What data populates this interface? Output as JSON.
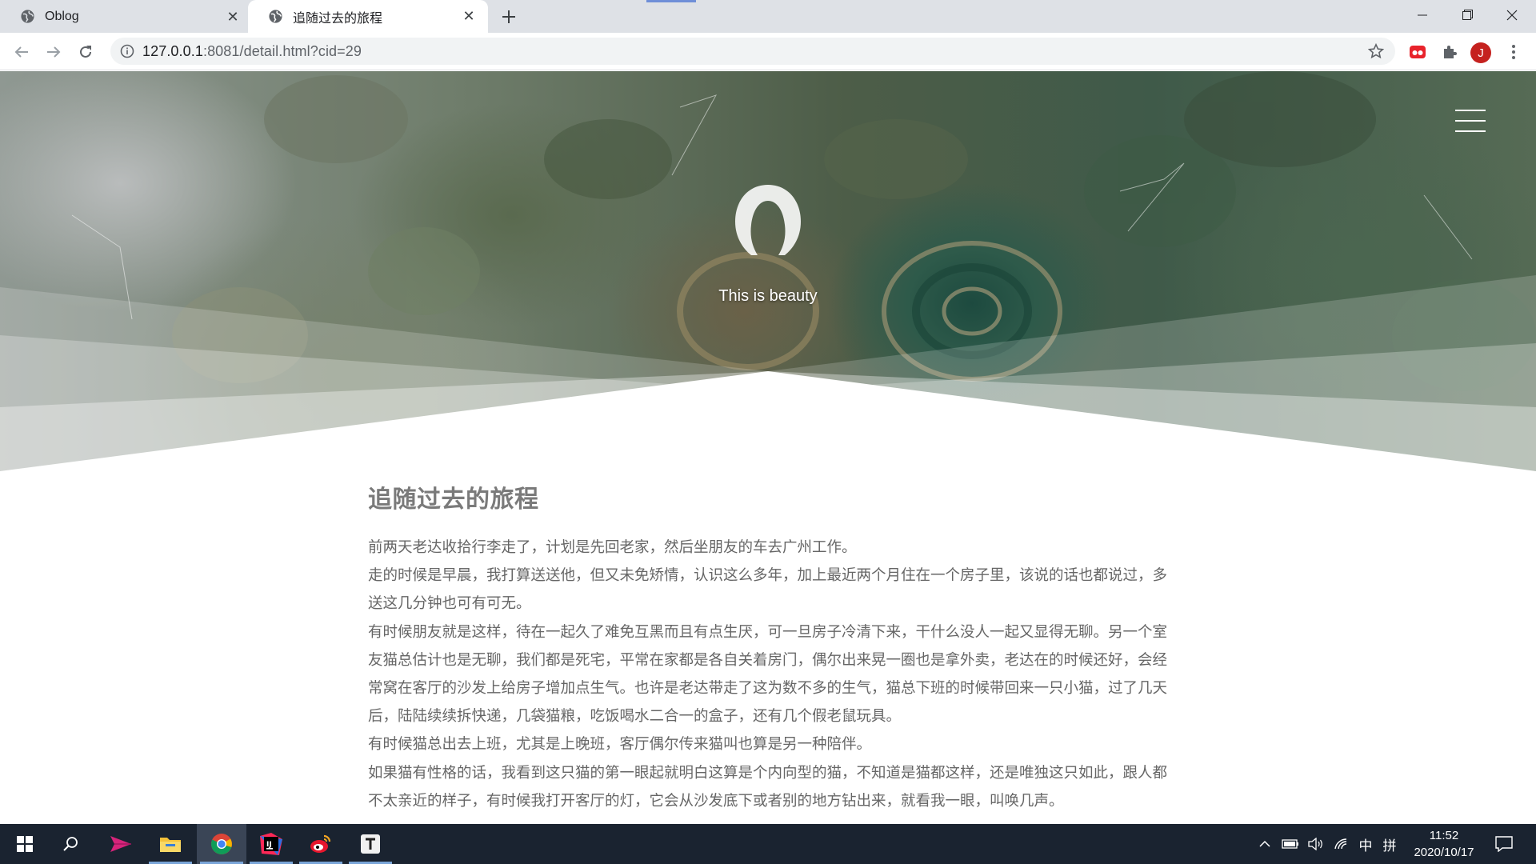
{
  "browser": {
    "tabs": [
      {
        "title": "Oblog",
        "active": false
      },
      {
        "title": "追随过去的旅程",
        "active": true
      }
    ],
    "url_host": "127.0.0.1",
    "url_rest": ":8081/detail.html?cid=29",
    "avatar_letter": "J"
  },
  "hero": {
    "motto": "This is beauty"
  },
  "article": {
    "title": "追随过去的旅程",
    "paragraphs": [
      "前两天老达收拾行李走了，计划是先回老家，然后坐朋友的车去广州工作。",
      "走的时候是早晨，我打算送送他，但又未免矫情，认识这么多年，加上最近两个月住在一个房子里，该说的话也都说过，多送这几分钟也可有可无。",
      "有时候朋友就是这样，待在一起久了难免互黑而且有点生厌，可一旦房子冷清下来，干什么没人一起又显得无聊。另一个室友猫总估计也是无聊，我们都是死宅，平常在家都是各自关着房门，偶尔出来晃一圈也是拿外卖，老达在的时候还好，会经常窝在客厅的沙发上给房子增加点生气。也许是老达带走了这为数不多的生气，猫总下班的时候带回来一只小猫，过了几天后，陆陆续续拆快递，几袋猫粮，吃饭喝水二合一的盒子，还有几个假老鼠玩具。",
      "有时候猫总出去上班，尤其是上晚班，客厅偶尔传来猫叫也算是另一种陪伴。",
      "如果猫有性格的话，我看到这只猫的第一眼起就明白这算是个内向型的猫，不知道是猫都这样，还是唯独这只如此，跟人都不太亲近的样子，有时候我打开客厅的灯，它会从沙发底下或者别的地方钻出来，就看我一眼，叫唤几声。"
    ]
  },
  "taskbar": {
    "ime_lang": "中",
    "ime_mode": "拼",
    "time": "11:52",
    "date": "2020/10/17"
  },
  "colors": {
    "tabstrip": "#dee1e6",
    "taskbar": "#1a2330",
    "avatar": "#c5221f",
    "article_text": "#666666"
  }
}
